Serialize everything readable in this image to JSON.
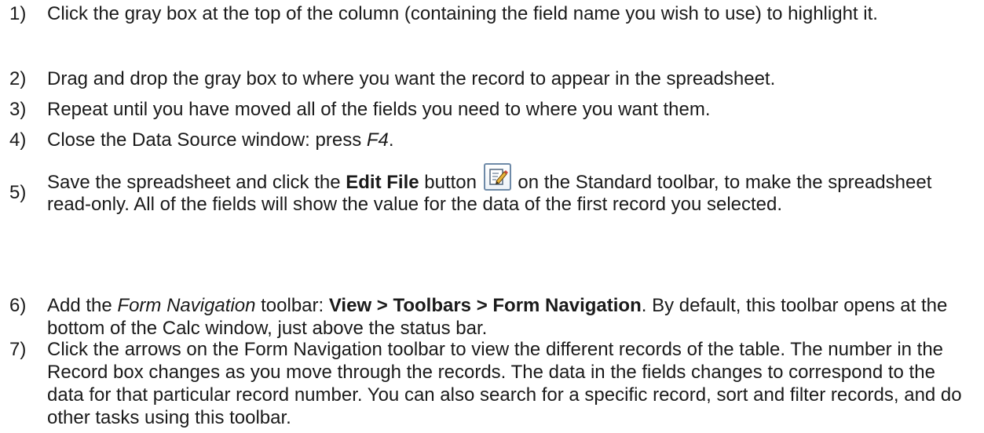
{
  "steps": [
    {
      "num": "1)",
      "text": "Click the gray box at the top of the column (containing the field name you wish to use) to highlight it."
    },
    {
      "num": "2)",
      "text": "Drag and drop the gray box to where you want the record to appear in the spreadsheet."
    },
    {
      "num": "3)",
      "text": "Repeat until you have moved all of the fields you need to where you want them."
    },
    {
      "num": "4)",
      "pre": "Close the Data Source window: press ",
      "em": "F4",
      "post": "."
    },
    {
      "num": "5)",
      "pre": "Save the spreadsheet and click the ",
      "strong": "Edit File",
      "mid": " button",
      "icon": "edit-file-icon",
      "post": " on the Standard toolbar, to make the spreadsheet read-only. All of the fields will show the value for the data of the first record you selected."
    },
    {
      "num": "6)",
      "pre": "Add the ",
      "em": "Form Navigation",
      "mid": " toolbar: ",
      "strong": "View > Toolbars > Form Navigation",
      "post": ". By default, this toolbar opens at the bottom of the Calc window, just above the status bar."
    },
    {
      "num": "7)",
      "text": "Click the arrows on the Form Navigation toolbar to view the different records of the table. The number in the Record box changes as you move through the records. The data in the fields changes to correspond to the data for that particular record number. You can also search for a specific record, sort and filter records, and do other tasks using this toolbar."
    }
  ]
}
